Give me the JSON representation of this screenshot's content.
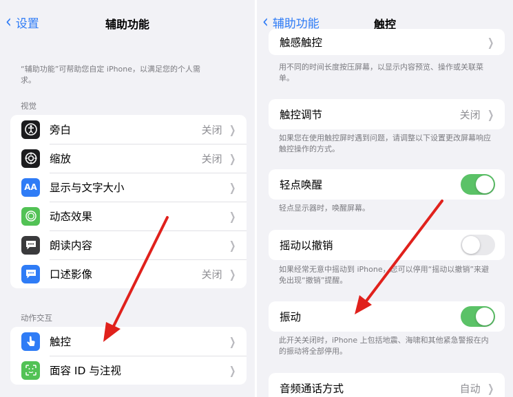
{
  "left": {
    "back_label": "设置",
    "title": "辅助功能",
    "intro": "“辅助功能”可帮助您自定 iPhone，以满足您的个人需求。",
    "vision_header": "视觉",
    "vision_items": [
      {
        "label": "旁白",
        "value": "关闭",
        "icon": "voiceover-icon",
        "color": "#1c1c1e"
      },
      {
        "label": "缩放",
        "value": "关闭",
        "icon": "zoom-icon",
        "color": "#1c1c1e"
      },
      {
        "label": "显示与文字大小",
        "value": "",
        "icon": "text-size-icon",
        "glyph": "AA",
        "color": "#2f7cf6"
      },
      {
        "label": "动态效果",
        "value": "",
        "icon": "motion-icon",
        "color": "#52c255"
      },
      {
        "label": "朗读内容",
        "value": "",
        "icon": "spoken-content-icon",
        "color": "#3a3a3c"
      },
      {
        "label": "口述影像",
        "value": "关闭",
        "icon": "audio-description-icon",
        "color": "#2f7cf6"
      }
    ],
    "interaction_header": "动作交互",
    "interaction_items": [
      {
        "label": "触控",
        "value": "",
        "icon": "touch-icon",
        "color": "#2f7cf6"
      },
      {
        "label": "面容 ID 与注视",
        "value": "",
        "icon": "face-id-icon",
        "color": "#52c255"
      }
    ]
  },
  "right": {
    "back_label": "辅助功能",
    "title": "触控",
    "haptic_touch": {
      "label": "触感触控"
    },
    "haptic_note": "用不同的时间长度按压屏幕，以显示内容预览、操作或关联菜单。",
    "touch_accommodations": {
      "label": "触控调节",
      "value": "关闭"
    },
    "accommodations_note": "如果您在使用触控屏时遇到问题，请调整以下设置更改屏幕响应触控操作的方式。",
    "tap_to_wake": {
      "label": "轻点唤醒",
      "on": true
    },
    "tap_note": "轻点显示器时，唤醒屏幕。",
    "shake_to_undo": {
      "label": "摇动以撤销",
      "on": false
    },
    "shake_note": "如果经常无意中摇动到 iPhone，您可以停用“摇动以撤销”来避免出现“撤销”提醒。",
    "vibration": {
      "label": "振动",
      "on": true
    },
    "vibration_note": "此开关关闭时，iPhone 上包括地震、海啸和其他紧急警报在内的振动将全部停用。",
    "call_audio": {
      "label": "音频通话方式",
      "value": "自动"
    }
  },
  "colors": {
    "accent": "#2f7cf6",
    "toggle_on": "#5bc267",
    "arrow": "#e0211c"
  }
}
